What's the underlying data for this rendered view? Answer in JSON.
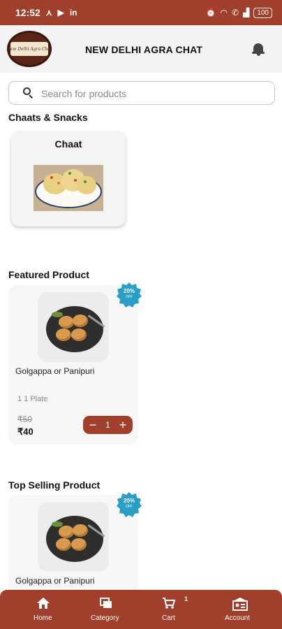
{
  "status_bar": {
    "time": "12:52",
    "left_icons": [
      "missed-call-icon",
      "youtube-icon",
      "linkedin-icon"
    ],
    "right_icons": [
      "alarm-icon",
      "wifi-icon",
      "wifi-call-icon",
      "signal-icon"
    ],
    "battery": "100"
  },
  "header": {
    "logo_text": "New Delhi Agra Chat",
    "title": "NEW DELHI AGRA CHAT"
  },
  "search": {
    "placeholder": "Search for products",
    "value": ""
  },
  "categories": {
    "section_title": "Chaats & Snacks",
    "items": [
      {
        "label": "Chaat"
      }
    ]
  },
  "featured": {
    "section_title": "Featured Product",
    "product": {
      "name": "Golgappa or Panipuri",
      "unit": "1 1 Plate",
      "old_price": "₹50",
      "new_price": "₹40",
      "discount": "20%",
      "discount_suffix": "OFF",
      "quantity": "1",
      "decrement": "−",
      "increment": "+"
    }
  },
  "top_selling": {
    "section_title": "Top Selling Product",
    "product": {
      "name": "Golgappa or Panipuri",
      "discount": "20%",
      "discount_suffix": "OFF"
    }
  },
  "bottom_nav": {
    "items": [
      {
        "label": "Home",
        "icon": "home-icon"
      },
      {
        "label": "Category",
        "icon": "category-icon"
      },
      {
        "label": "Cart",
        "icon": "cart-icon"
      },
      {
        "label": "Account",
        "icon": "account-icon"
      }
    ],
    "cart_count": "1"
  },
  "colors": {
    "brand": "#a0402c",
    "badge": "#2a9ec4",
    "card_bg": "#f7f7f7"
  }
}
